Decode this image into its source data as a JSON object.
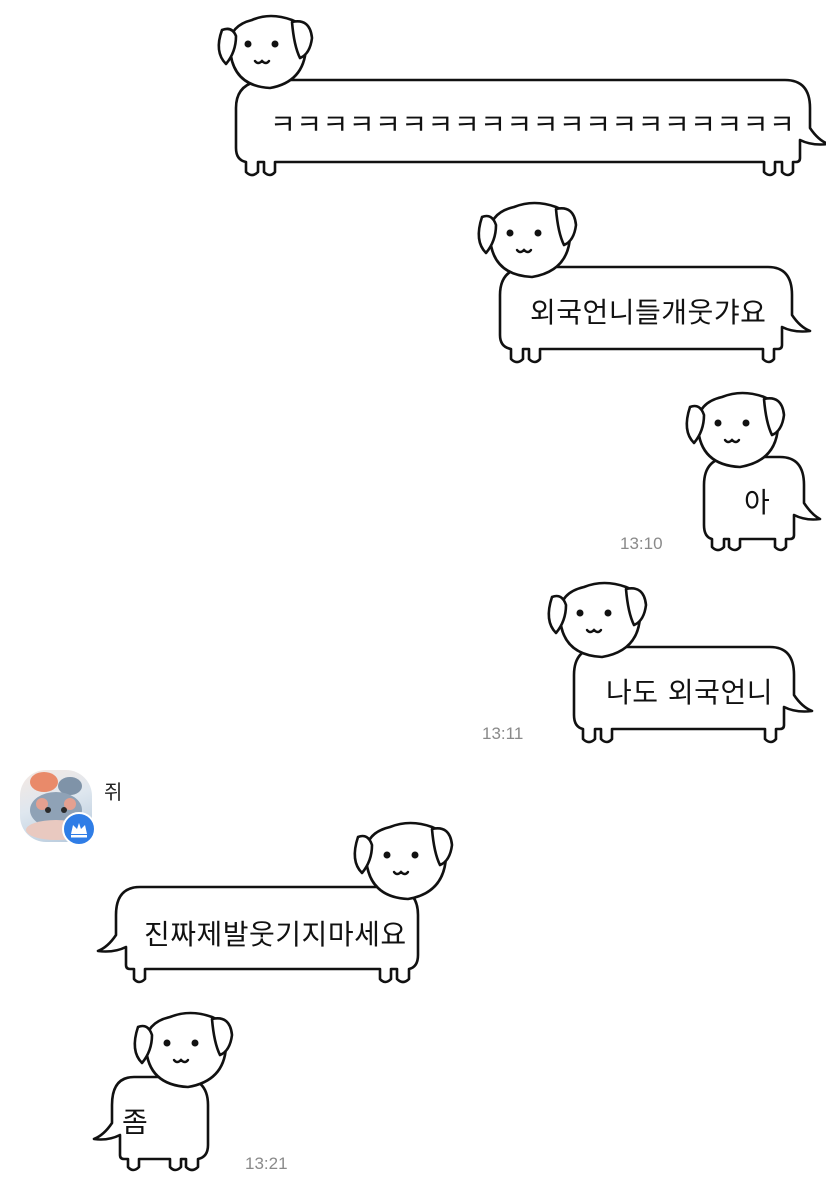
{
  "chat": {
    "sender_name": "쥐",
    "messages": [
      {
        "text": "ㅋㅋㅋㅋㅋㅋㅋㅋㅋㅋㅋㅋㅋㅋㅋㅋㅋㅋㅋㅋ",
        "time": ""
      },
      {
        "text": "외국언니들개웃갸요",
        "time": ""
      },
      {
        "text": "아",
        "time": "13:10"
      },
      {
        "text": "나도 외국언니",
        "time": "13:11"
      },
      {
        "text": "진짜제발웃기지마세요",
        "time": ""
      },
      {
        "text": "좀",
        "time": "13:21"
      }
    ]
  },
  "colors": {
    "background": "#ffffff",
    "outline": "#111111",
    "timestamp": "#8a8a8a",
    "badge": "#2f7de6"
  },
  "icons": {
    "avatar": "rat-avatar",
    "badge": "crown-icon",
    "sticker": "long-dog-sticker"
  }
}
